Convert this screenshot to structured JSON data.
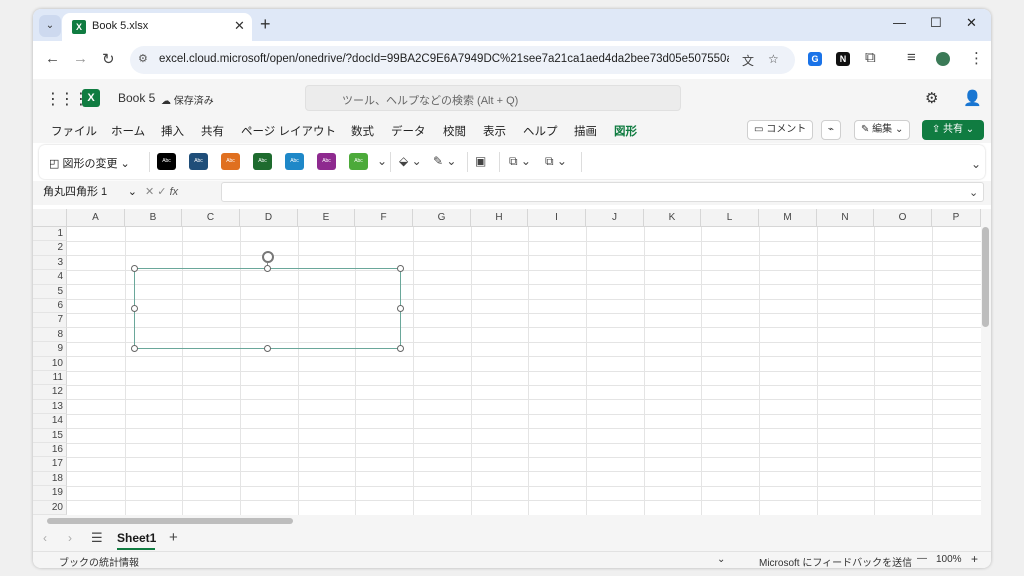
{
  "browser": {
    "tab_title": "Book 5.xlsx",
    "tab_close": "✕",
    "new_tab": "+",
    "url": "excel.cloud.microsoft/open/onedrive/?docId=99BA2C9E6A7949DC%21see7a21ca1aed4da2bee73d05e507550a&d...",
    "minimize": "—",
    "maximize": "☐",
    "close": "✕"
  },
  "excel": {
    "doc_name": "Book 5",
    "save_status": "保存済み",
    "search_placeholder": "ツール、ヘルプなどの検索 (Alt + Q)",
    "menu": [
      "ファイル",
      "ホーム",
      "挿入",
      "共有",
      "ページ レイアウト",
      "数式",
      "データ",
      "校閲",
      "表示",
      "ヘルプ",
      "描画",
      "図形"
    ],
    "active_menu": "図形",
    "comment_btn": "コメント",
    "edit_btn": "編集",
    "share_btn": "共有"
  },
  "ribbon": {
    "change_shape": "図形の変更",
    "swatch_label": "Abc",
    "swatch_colors": [
      "#000000",
      "#1f4e79",
      "#e07020",
      "#1e6b2e",
      "#1e88c8",
      "#8e2a8f",
      "#4caa3a"
    ]
  },
  "formula_bar": {
    "name_box": "角丸四角形 1",
    "fx": "fx"
  },
  "grid": {
    "columns": [
      "A",
      "B",
      "C",
      "D",
      "E",
      "F",
      "G",
      "H",
      "I",
      "J",
      "K",
      "L",
      "M",
      "N",
      "O",
      "P"
    ],
    "rows": [
      "1",
      "2",
      "3",
      "4",
      "5",
      "6",
      "7",
      "8",
      "9",
      "10",
      "11",
      "12",
      "13",
      "14",
      "15",
      "16",
      "17",
      "18",
      "19",
      "20"
    ]
  },
  "sheets": {
    "active": "Sheet1",
    "add": "+"
  },
  "status": {
    "left": "ブックの統計情報",
    "feedback": "Microsoft にフィードバックを送信",
    "zoom": "100%",
    "zoom_out": "—",
    "zoom_in": "+"
  }
}
